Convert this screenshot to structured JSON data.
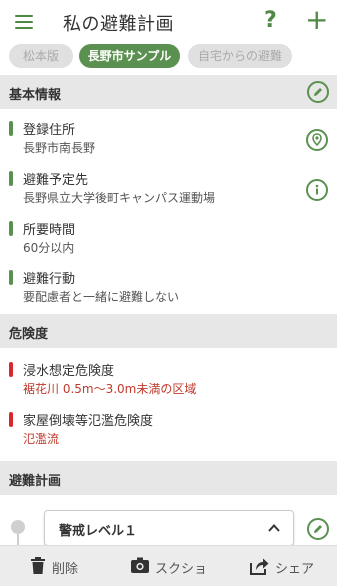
{
  "header": {
    "title": "私の避難計画",
    "help_label": "?",
    "add_label": "+"
  },
  "tabs": [
    {
      "label": "松本版",
      "active": false
    },
    {
      "label": "長野市サンプル",
      "active": true
    },
    {
      "label": "自宅からの避難",
      "active": false
    }
  ],
  "basic": {
    "title": "基本情報",
    "items": [
      {
        "label": "登録住所",
        "value": "長野市南長野",
        "icon": "location-pin-icon"
      },
      {
        "label": "避難予定先",
        "value": "長野県立大学後町キャンパス運動場",
        "icon": "info-icon"
      },
      {
        "label": "所要時間",
        "value": "60分以内"
      },
      {
        "label": "避難行動",
        "value": "要配慮者と一緒に避難しない"
      }
    ]
  },
  "danger": {
    "title": "危険度",
    "items": [
      {
        "label": "浸水想定危険度",
        "value": "裾花川 0.5m〜3.0m未満の区域"
      },
      {
        "label": "家屋倒壊等氾濫危険度",
        "value": "氾濫流"
      }
    ]
  },
  "plan": {
    "title": "避難計画",
    "alert_level": "警戒レベル１"
  },
  "bottom_bar": {
    "delete_label": "削除",
    "screenshot_label": "スクショ",
    "share_label": "シェア"
  },
  "colors": {
    "accent": "#5b9150",
    "danger": "#d9262f",
    "section_bg": "#e7e7e7"
  }
}
